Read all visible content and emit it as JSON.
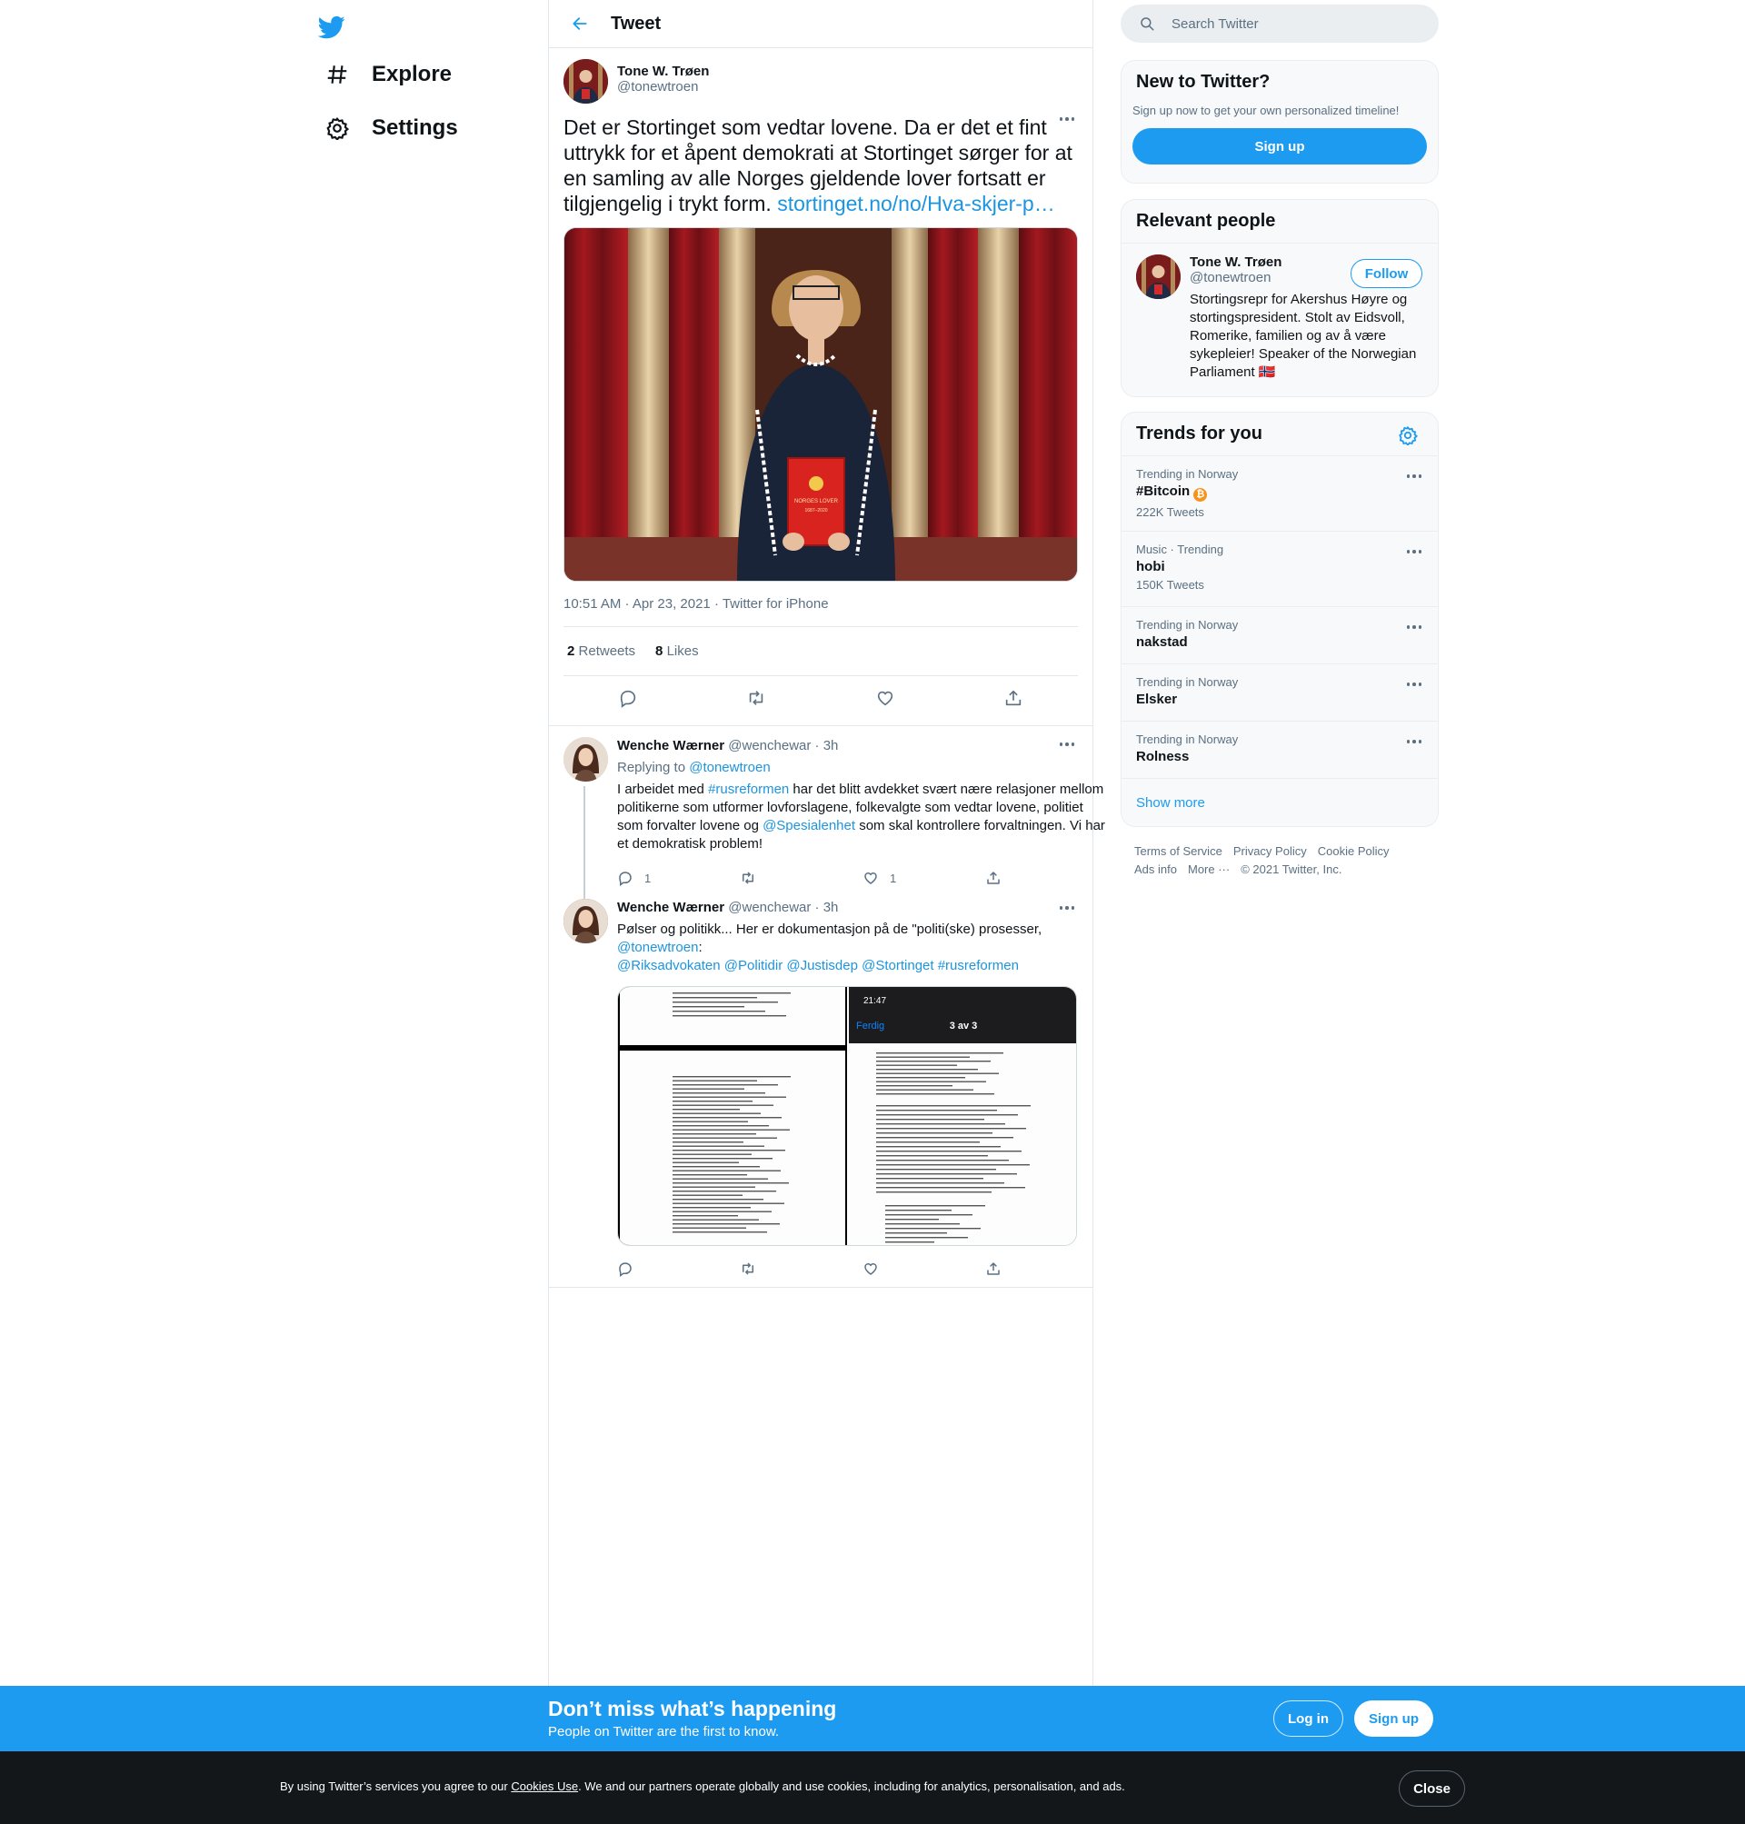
{
  "nav": {
    "explore_label": "Explore",
    "settings_label": "Settings"
  },
  "header": {
    "title": "Tweet"
  },
  "focal_tweet": {
    "author_name": "Tone W. Trøen",
    "author_handle": "@tonewtroen",
    "text": "Det er Stortinget som vedtar lovene. Da er det et fint uttrykk for et åpent demokrati at Stortinget sørger for at en samling av alle Norges gjeldende lover fortsatt er tilgjengelig i trykt form.",
    "link_text": "stortinget.no/no/Hva-skjer-p…",
    "book_title": "NORGES LOVER",
    "book_years": "1687–2020",
    "meta": "10:51 AM · Apr 23, 2021 · Twitter for iPhone",
    "retweets_count": "2",
    "retweets_label": "Retweets",
    "likes_count": "8",
    "likes_label": "Likes"
  },
  "replies": [
    {
      "author_name": "Wenche Wærner",
      "author_handle": "@wenchewar",
      "time": "· 3h",
      "replying_label": "Replying to",
      "replying_to": "@tonewtroen",
      "t1": "I arbeidet med ",
      "l1": "#rusreformen",
      "t2": " har det blitt avdekket svært nære relasjoner mellom politikerne som utformer lovforslagene, folkevalgte som vedtar lovene, politiet som forvalter lovene og ",
      "l2": "@Spesialenhet",
      "t3": " som skal kontrollere forvaltningen. Vi har et demokratisk problem!",
      "reply_count": "1",
      "retweet_count": "",
      "like_count": "1"
    },
    {
      "author_name": "Wenche Wærner",
      "author_handle": "@wenchewar",
      "time": "· 3h",
      "t1": "Pølser og politikk... Her er dokumentasjon på de \"politi(ske) prosesser,",
      "l1": "@tonewtroen",
      "t2": ":",
      "tags": "@Riksadvokaten @Politidir @Justisdep @Stortinget #rusreformen",
      "phone_time": "21:47",
      "phone_done": "Ferdig",
      "phone_page": "3 av 3"
    }
  ],
  "sidebar": {
    "search_placeholder": "Search Twitter",
    "new_title": "New to Twitter?",
    "new_sub": "Sign up now to get your own personalized timeline!",
    "signup_label": "Sign up",
    "relevant_title": "Relevant people",
    "person_name": "Tone W. Trøen",
    "person_handle": "@tonewtroen",
    "follow_label": "Follow",
    "person_bio": "Stortingsrepr for Akershus Høyre og stortingspresident. Stolt av Eidsvoll, Romerike, familien og av å være sykepleier! Speaker of the Norwegian Parliament 🇳🇴",
    "trends_title": "Trends for you",
    "trends": [
      {
        "meta": "Trending in Norway",
        "name": "#Bitcoin",
        "count": "222K Tweets"
      },
      {
        "meta": "Music · Trending",
        "name": "hobi",
        "count": "150K Tweets"
      },
      {
        "meta": "Trending in Norway",
        "name": "nakstad",
        "count": ""
      },
      {
        "meta": "Trending in Norway",
        "name": "Elsker",
        "count": ""
      },
      {
        "meta": "Trending in Norway",
        "name": "Rolness",
        "count": ""
      }
    ],
    "show_more": "Show more",
    "footer": {
      "terms": "Terms of Service",
      "privacy": "Privacy Policy",
      "cookie": "Cookie Policy",
      "ads": "Ads info",
      "more": "More ···",
      "copyright": "© 2021 Twitter, Inc."
    }
  },
  "bottom_bar": {
    "title": "Don’t miss what’s happening",
    "subtitle": "People on Twitter are the first to know.",
    "login_label": "Log in",
    "signup_label": "Sign up"
  },
  "cookie_bar": {
    "prefix": "By using Twitter’s services you agree to our ",
    "link": "Cookies Use",
    "suffix": ". We and our partners operate globally and use cookies, including for analytics, personalisation, and ads.",
    "close_label": "Close"
  },
  "colors": {
    "accent": "#1d9bf0",
    "link": "#1b95e0",
    "muted": "#5b7083",
    "cookie_bg": "#14171a"
  }
}
